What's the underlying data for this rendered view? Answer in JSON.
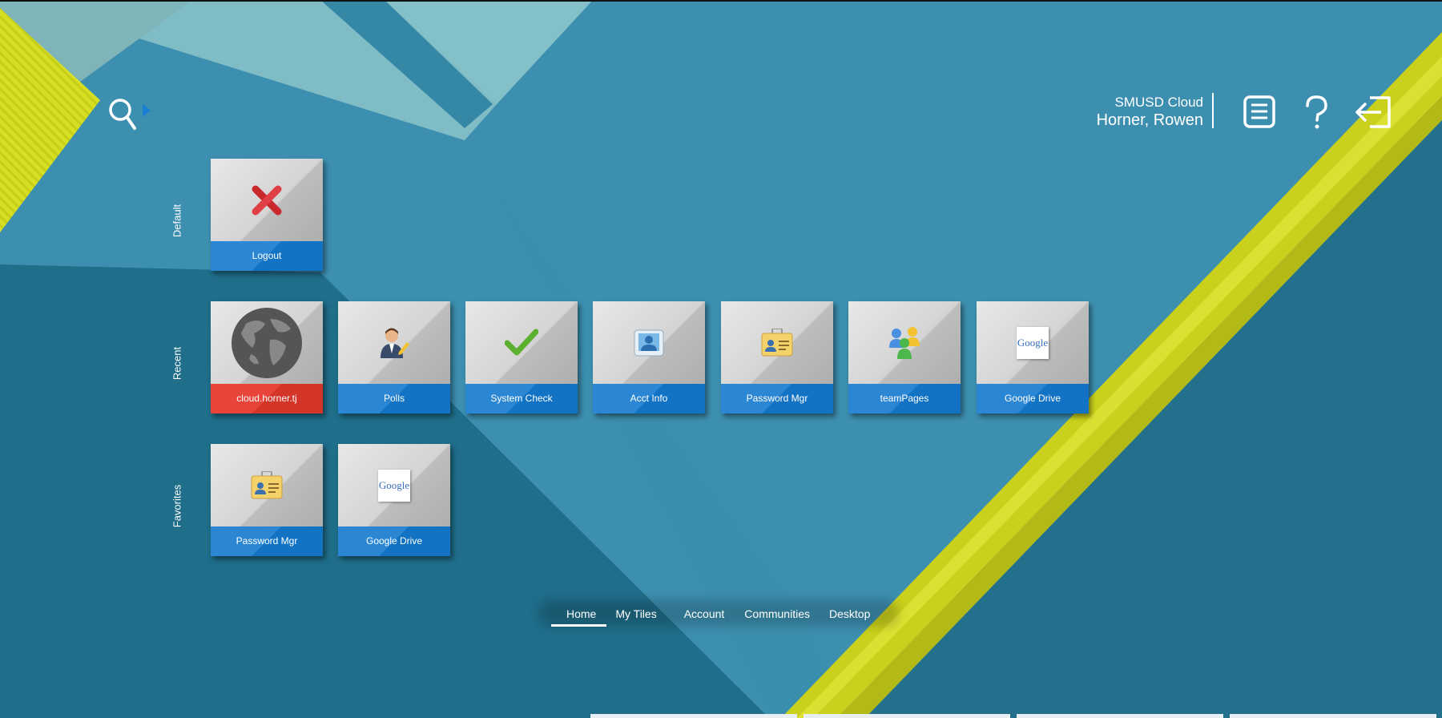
{
  "header": {
    "org_name": "SMUSD Cloud",
    "user_name": "Horner, Rowen",
    "icons": [
      "search-icon",
      "menu-icon",
      "help-icon",
      "logout-icon"
    ]
  },
  "groups": [
    {
      "label": "Default",
      "tiles": [
        {
          "label": "Logout",
          "icon": "red-x-icon",
          "accent": "#1273c4"
        }
      ]
    },
    {
      "label": "Recent",
      "tiles": [
        {
          "label": "cloud.horner.tj",
          "icon": "globe-icon",
          "accent": "#d33528"
        },
        {
          "label": "Polls",
          "icon": "person-pencil-icon",
          "accent": "#1273c4"
        },
        {
          "label": "System Check",
          "icon": "checkmark-icon",
          "accent": "#1273c4"
        },
        {
          "label": "Acct Info",
          "icon": "user-card-icon",
          "accent": "#1273c4"
        },
        {
          "label": "Password Mgr",
          "icon": "id-badge-icon",
          "accent": "#1273c4"
        },
        {
          "label": "teamPages",
          "icon": "group-people-icon",
          "accent": "#1273c4"
        },
        {
          "label": "Google Drive",
          "icon": "google-icon",
          "accent": "#1273c4"
        }
      ]
    },
    {
      "label": "Favorites",
      "tiles": [
        {
          "label": "Password Mgr",
          "icon": "id-badge-icon",
          "accent": "#1273c4"
        },
        {
          "label": "Google Drive",
          "icon": "google-icon",
          "accent": "#1273c4"
        }
      ]
    }
  ],
  "google_logo_text": "Google",
  "nav": {
    "items": [
      "Home",
      "My Tiles",
      "Account",
      "Communities",
      "Desktop"
    ],
    "active": "Home"
  },
  "colors": {
    "tile_blue": "#1273c4",
    "tile_red": "#d33528",
    "yellow_stripe": "#d4dc1e",
    "bg_teal": "#1e6f8c"
  }
}
